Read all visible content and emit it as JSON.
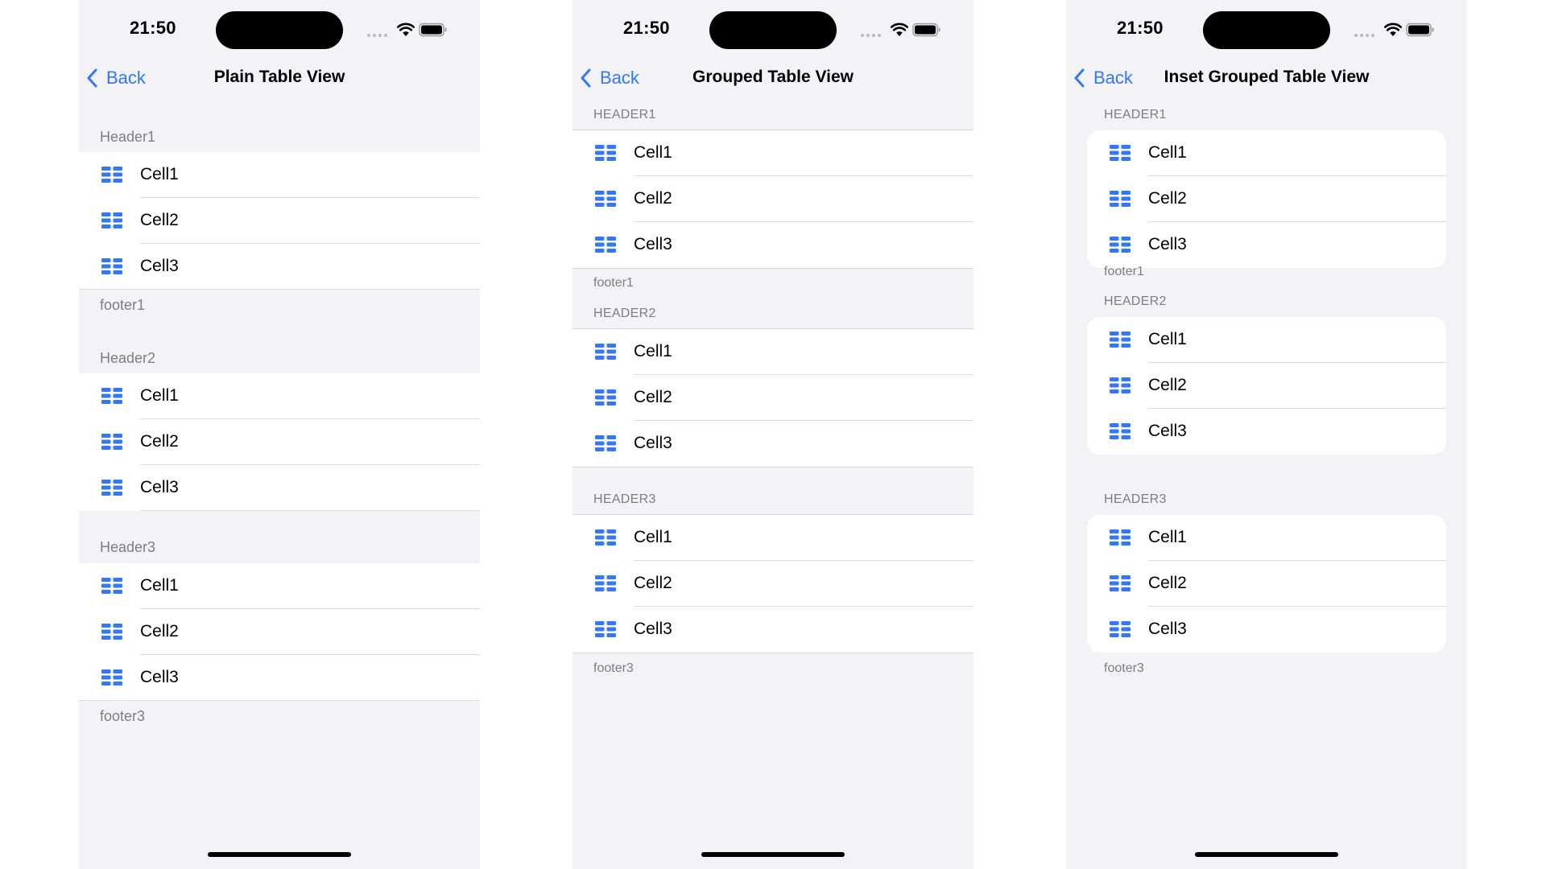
{
  "status": {
    "time": "21:50"
  },
  "colors": {
    "accent": "#3478f6",
    "background": "#f2f2f7",
    "cell": "#ffffff",
    "secondary_text": "#7d7d82"
  },
  "icons": {
    "back": "chevron-left-icon",
    "cell": "table-grid-icon",
    "wifi": "wifi-icon",
    "battery": "battery-icon"
  },
  "plain": {
    "back": "Back",
    "title": "Plain Table View",
    "sections": [
      {
        "header": "Header1",
        "cells": [
          "Cell1",
          "Cell2",
          "Cell3"
        ],
        "footer": "footer1"
      },
      {
        "header": "Header2",
        "cells": [
          "Cell1",
          "Cell2",
          "Cell3"
        ],
        "footer": ""
      },
      {
        "header": "Header3",
        "cells": [
          "Cell1",
          "Cell2",
          "Cell3"
        ],
        "footer": "footer3"
      }
    ]
  },
  "grouped": {
    "back": "Back",
    "title": "Grouped Table View",
    "sections": [
      {
        "header": "Header1",
        "cells": [
          "Cell1",
          "Cell2",
          "Cell3"
        ],
        "footer": "footer1"
      },
      {
        "header": "Header2",
        "cells": [
          "Cell1",
          "Cell2",
          "Cell3"
        ],
        "footer": ""
      },
      {
        "header": "Header3",
        "cells": [
          "Cell1",
          "Cell2",
          "Cell3"
        ],
        "footer": "footer3"
      }
    ]
  },
  "inset": {
    "back": "Back",
    "title": "Inset Grouped Table View",
    "sections": [
      {
        "header": "Header1",
        "cells": [
          "Cell1",
          "Cell2",
          "Cell3"
        ],
        "footer": "footer1"
      },
      {
        "header": "Header2",
        "cells": [
          "Cell1",
          "Cell2",
          "Cell3"
        ],
        "footer": ""
      },
      {
        "header": "Header3",
        "cells": [
          "Cell1",
          "Cell2",
          "Cell3"
        ],
        "footer": "footer3"
      }
    ]
  }
}
